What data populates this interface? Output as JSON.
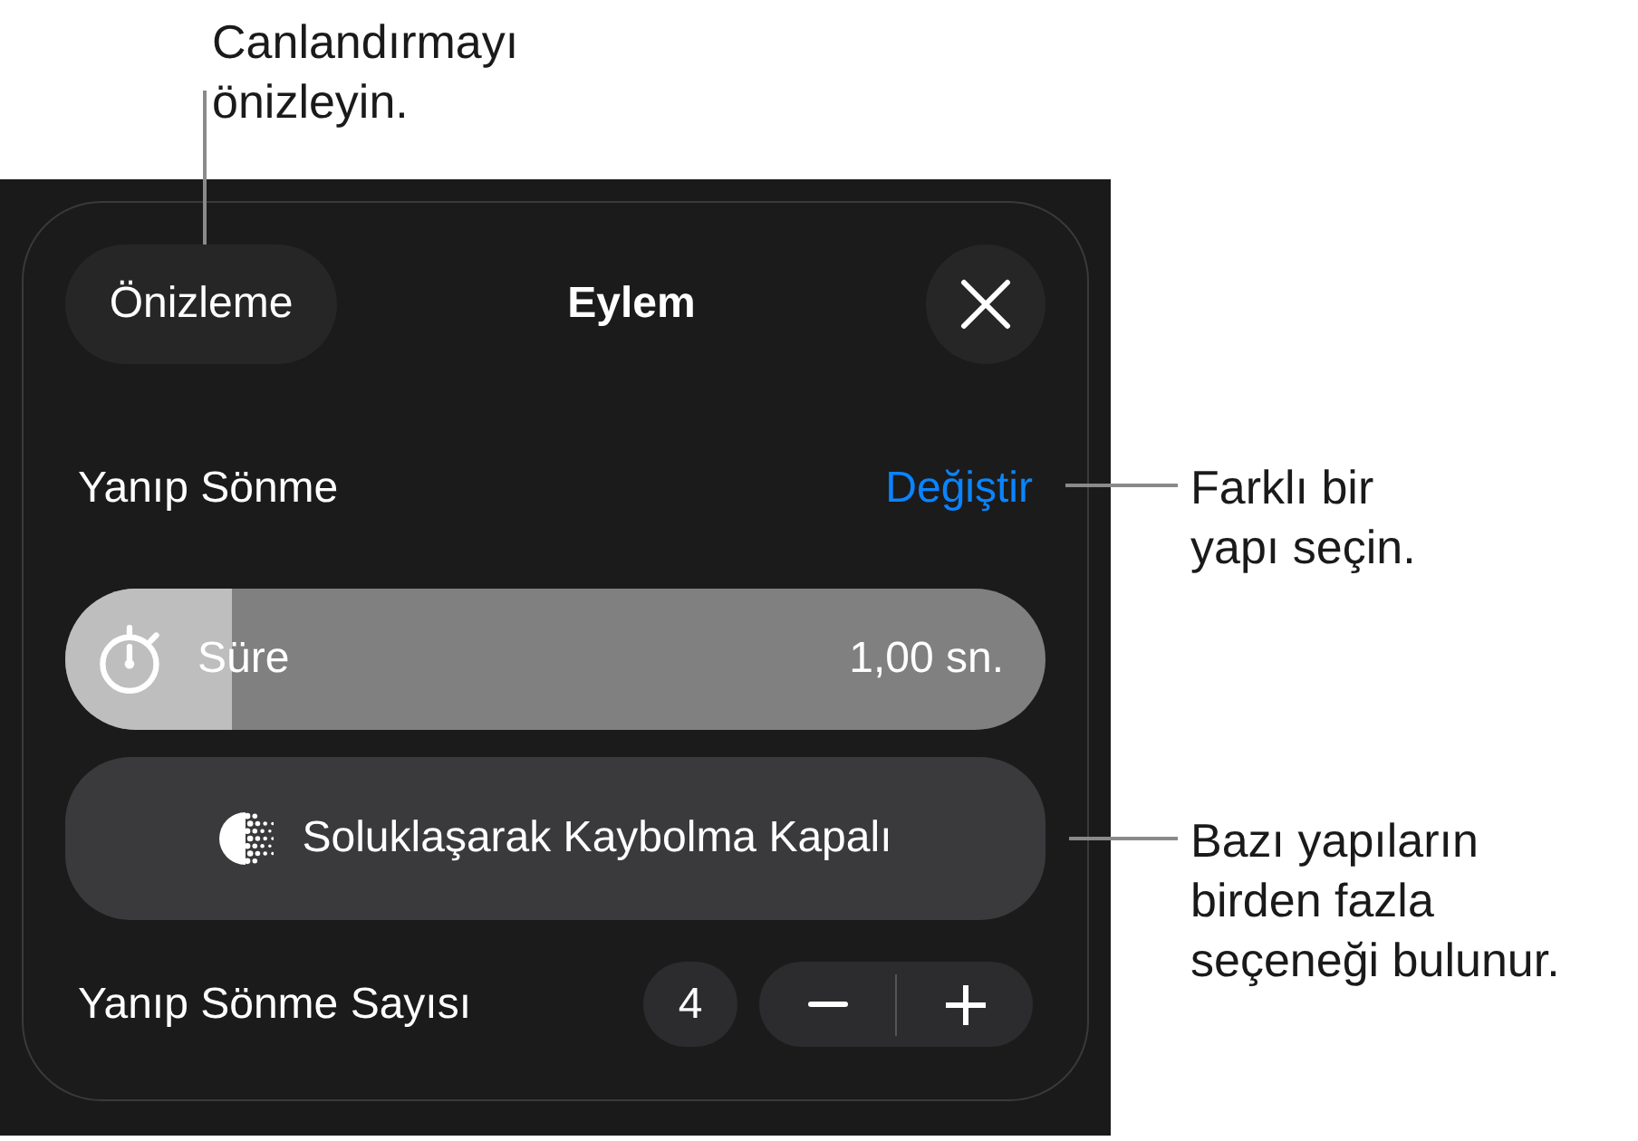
{
  "callouts": [
    {
      "text": "Canlandırmayı önizleyin."
    },
    {
      "text": "Farklı bir yapı seçin."
    },
    {
      "text": "Bazı yapıların birden fazla seçeneği bulunur."
    }
  ],
  "panel": {
    "preview_button": "Önizleme",
    "title": "Eylem",
    "animation": {
      "name": "Yanıp Sönme",
      "change_link": "Değiştir"
    },
    "duration": {
      "label": "Süre",
      "reading": "1,00 sn.",
      "level": 0.17
    },
    "fade_button": "Soluklaşarak Kaybolma Kapalı",
    "count": {
      "label": "Yanıp Sönme Sayısı",
      "value": "4"
    }
  }
}
